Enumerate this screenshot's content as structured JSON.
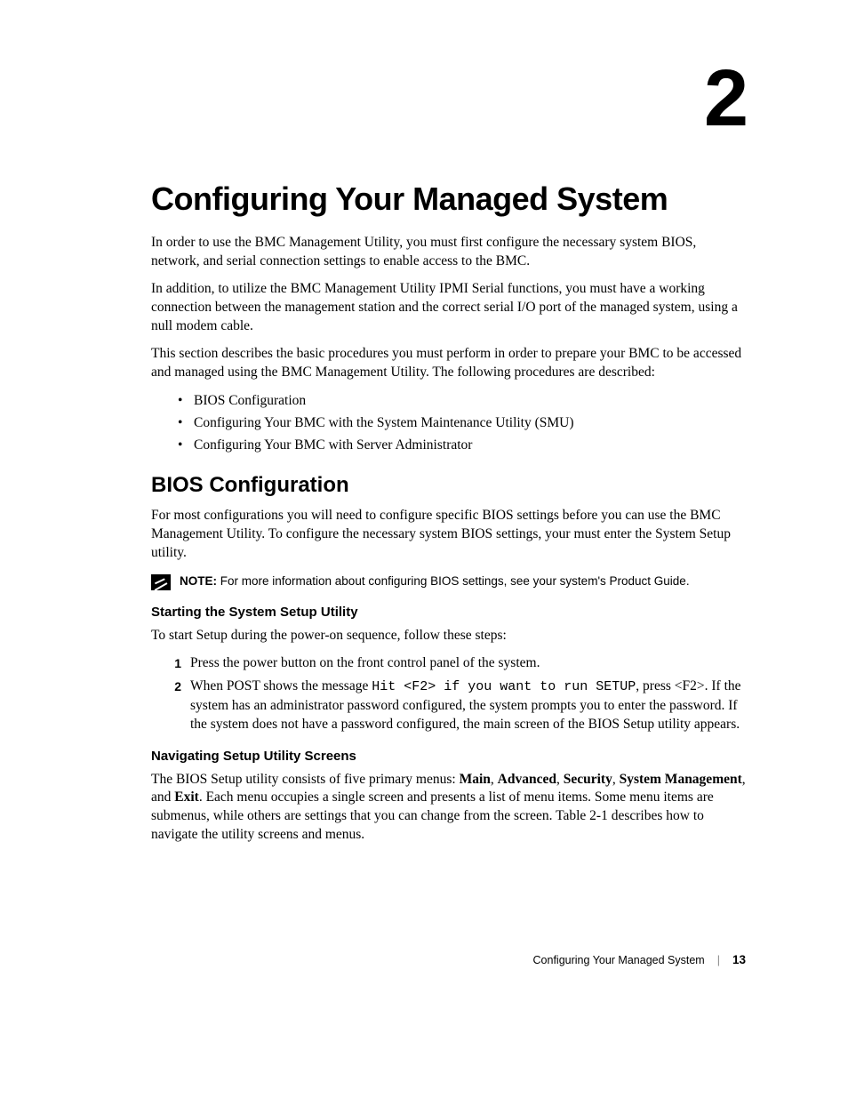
{
  "chapter_number": "2",
  "main_title": "Configuring Your Managed System",
  "para1": "In order to use the BMC Management Utility, you must first configure the necessary system BIOS, network, and serial connection settings to enable access to the BMC.",
  "para2": "In addition, to utilize the BMC Management Utility IPMI Serial functions, you must have a working connection between the management station and the correct serial I/O port of the managed system, using a null modem cable.",
  "para3": "This section describes the basic procedures you must perform in order to prepare your BMC to be accessed and managed using the BMC Management Utility. The following procedures are described:",
  "bullets": [
    "BIOS Configuration",
    "Configuring Your BMC with the System Maintenance Utility (SMU)",
    "Configuring Your BMC with Server Administrator"
  ],
  "section1_title": "BIOS Configuration",
  "section1_para": "For most configurations you will need to configure specific BIOS settings before you can use the BMC Management Utility. To configure the necessary system BIOS settings, your must enter the System Setup utility.",
  "note_label": "NOTE:",
  "note_text": " For more information about configuring BIOS settings, see your system's Product Guide.",
  "subsection1_title": "Starting the System Setup Utility",
  "subsection1_intro": "To start Setup during the power-on sequence, follow these steps:",
  "step1": "Press the power button on the front control panel of the system.",
  "step2_a": "When POST shows the message ",
  "step2_code": "Hit <F2> if you want to run SETUP",
  "step2_b": ", press <F2>. If the system has an administrator password configured, the system prompts you to enter the password. If the system does not have a password configured, the main screen of the BIOS Setup utility appears.",
  "subsection2_title": "Navigating Setup Utility Screens",
  "subsection2_a": "The BIOS Setup utility consists of five primary menus: ",
  "menu1": "Main",
  "menu2": "Advanced",
  "menu3": "Security",
  "menu4": "System Management",
  "menu5": "Exit",
  "subsection2_b": ". Each menu occupies a single screen and presents a list of menu items. Some menu items are submenus, while others are settings that you can change from the screen. Table 2-1 describes how to navigate the utility screens and menus.",
  "footer_title": "Configuring Your Managed System",
  "footer_page": "13"
}
